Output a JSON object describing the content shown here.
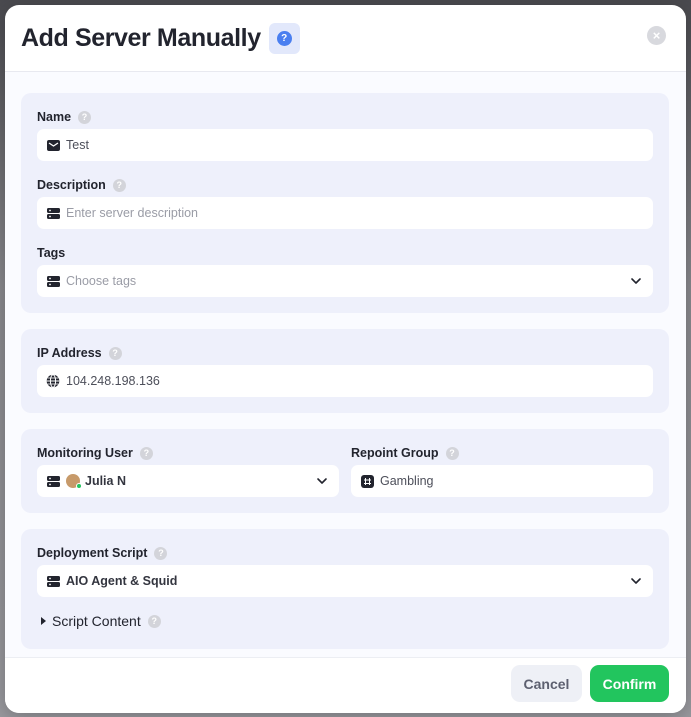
{
  "dialog": {
    "title": "Add Server Manually",
    "help_symbol": "?",
    "close_symbol": "×"
  },
  "basic": {
    "name": {
      "label": "Name",
      "value": "Test",
      "help": "?"
    },
    "description": {
      "label": "Description",
      "placeholder": "Enter server description",
      "help": "?"
    },
    "tags": {
      "label": "Tags",
      "placeholder": "Choose tags"
    }
  },
  "network": {
    "ip": {
      "label": "IP Address",
      "value": "104.248.198.136",
      "help": "?"
    }
  },
  "assignment": {
    "monitoring_user": {
      "label": "Monitoring User",
      "value": "Julia N",
      "help": "?"
    },
    "repoint_group": {
      "label": "Repoint Group",
      "value": "Gambling",
      "help": "?"
    }
  },
  "deployment": {
    "script": {
      "label": "Deployment Script",
      "value": "AIO Agent & Squid",
      "help": "?"
    },
    "script_content": {
      "label": "Script Content",
      "help": "?"
    }
  },
  "footer": {
    "cancel_label": "Cancel",
    "confirm_label": "Confirm"
  },
  "icons": {
    "mail": "mail-icon",
    "server": "server-icon",
    "globe": "globe-icon",
    "hash": "hash-icon",
    "chevron": "chevron-down-icon"
  },
  "colors": {
    "accent_green": "#22c55e",
    "help_blue": "#4a7ff0",
    "card_bg": "#eef0fb"
  }
}
